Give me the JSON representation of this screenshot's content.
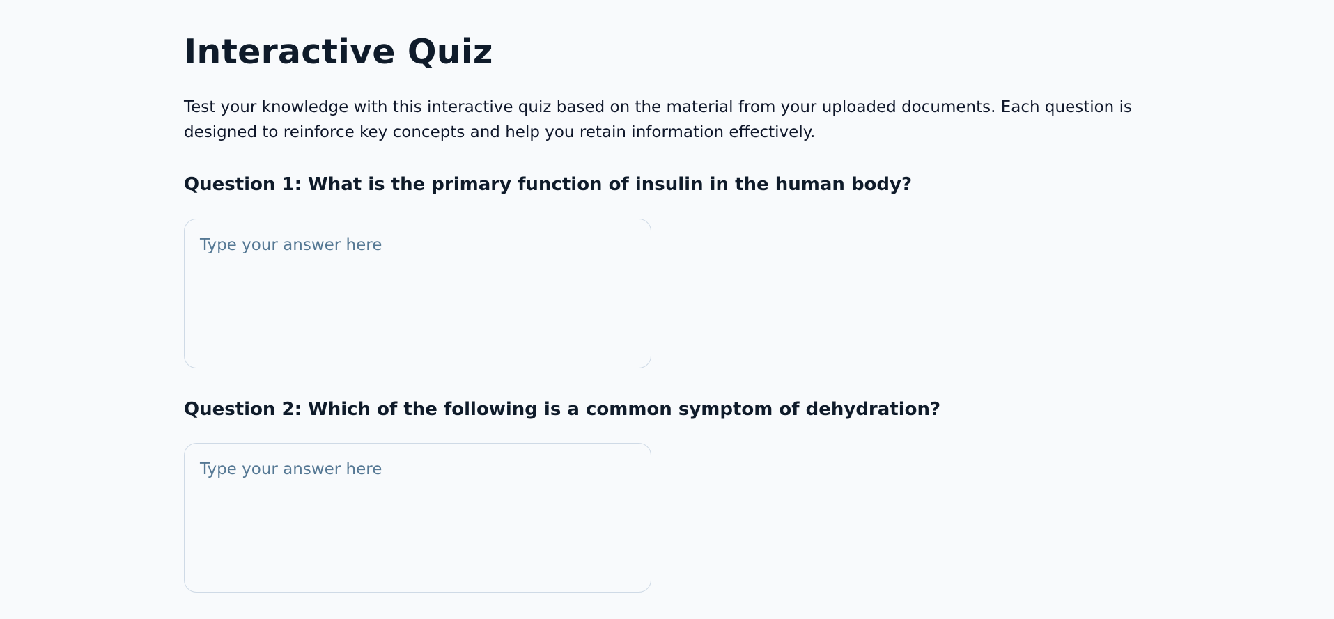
{
  "page": {
    "title": "Interactive Quiz",
    "intro": "Test your knowledge with this interactive quiz based on the material from your uploaded documents. Each question is designed to reinforce key concepts and help you retain information effectively."
  },
  "questions": [
    {
      "text": "Question 1: What is the primary function of insulin in the human body?",
      "answer_value": "",
      "answer_placeholder": "Type your answer here"
    },
    {
      "text": "Question 2: Which of the following is a common symptom of dehydration?",
      "answer_value": "",
      "answer_placeholder": "Type your answer here"
    }
  ],
  "colors": {
    "background": "#f8fafc",
    "text": "#0f172a",
    "placeholder": "#557894",
    "border": "#cfdae6"
  }
}
